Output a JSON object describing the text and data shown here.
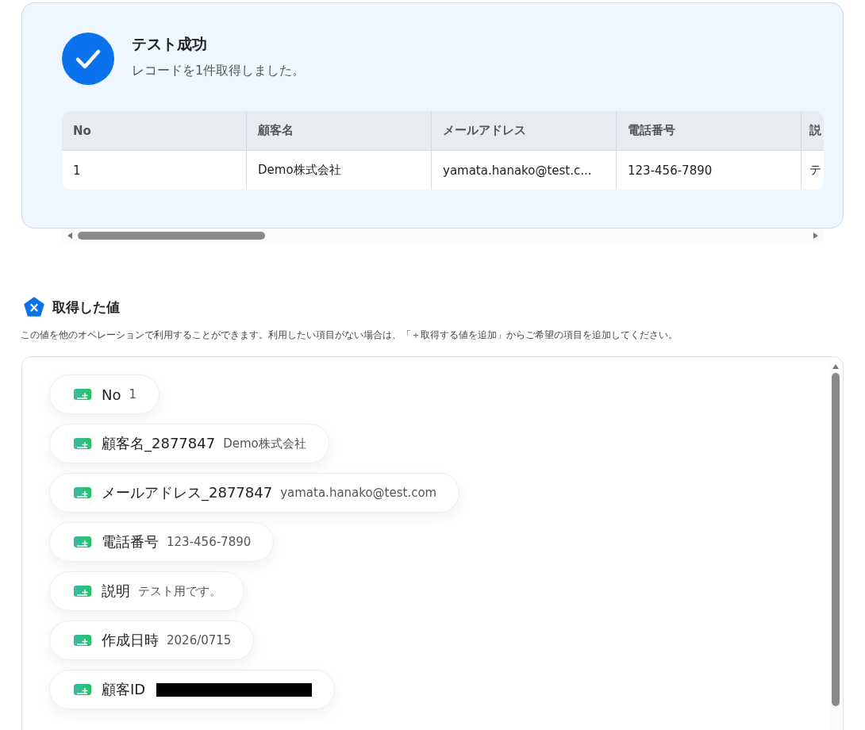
{
  "result": {
    "title": "テスト成功",
    "message": "レコードを1件取得しました。"
  },
  "table": {
    "columns": [
      "No",
      "顧客名",
      "メールアドレス",
      "電話番号",
      "説"
    ],
    "rows": [
      [
        "1",
        "Demo株式会社",
        "yamata.hanako@test.c...",
        "123-456-7890",
        "テ"
      ]
    ]
  },
  "section": {
    "title": "取得した値",
    "description": "この値を他のオペレーションで利用することができます。利用したい項目がない場合は、「＋取得する値を追加」からご希望の項目を追加してください。"
  },
  "values": [
    {
      "kind": "text",
      "label": "No",
      "value": "1"
    },
    {
      "kind": "text",
      "label": "顧客名_2877847",
      "value": "Demo株式会社"
    },
    {
      "kind": "text",
      "label": "メールアドレス_2877847",
      "value": "yamata.hanako@test.com"
    },
    {
      "kind": "text",
      "label": "電話番号",
      "value": "123-456-7890"
    },
    {
      "kind": "text",
      "label": "説明",
      "value": "テスト用です。"
    },
    {
      "kind": "text",
      "label": "作成日時",
      "value": "2026/0715"
    },
    {
      "kind": "redacted",
      "label": "顧客ID"
    }
  ]
}
